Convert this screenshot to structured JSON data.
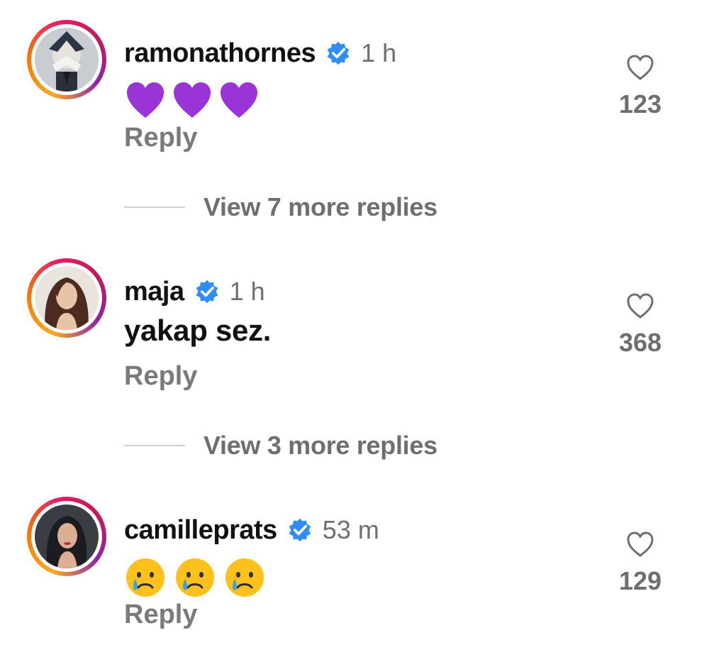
{
  "comments": [
    {
      "username": "ramonathornes",
      "time": "1 h",
      "text": "",
      "emojis": [
        "purple-heart",
        "purple-heart",
        "purple-heart"
      ],
      "reply_label": "Reply",
      "likes": "123"
    },
    {
      "username": "maja",
      "time": "1 h",
      "text": "yakap sez.",
      "emojis": [],
      "reply_label": "Reply",
      "likes": "368"
    },
    {
      "username": "camilleprats",
      "time": "53 m",
      "text": "",
      "emojis": [
        "crying-face",
        "crying-face",
        "crying-face"
      ],
      "reply_label": "Reply",
      "likes": "129"
    }
  ],
  "view_more": [
    {
      "label": "View 7 more replies"
    },
    {
      "label": "View 3 more replies"
    }
  ],
  "colors": {
    "verified_blue": "#2f8df5",
    "muted_text": "#6f6f6f",
    "heart_purple": "#9b34d6"
  },
  "icons": {
    "like": "heart-outline-icon",
    "verified": "verified-badge-icon"
  }
}
